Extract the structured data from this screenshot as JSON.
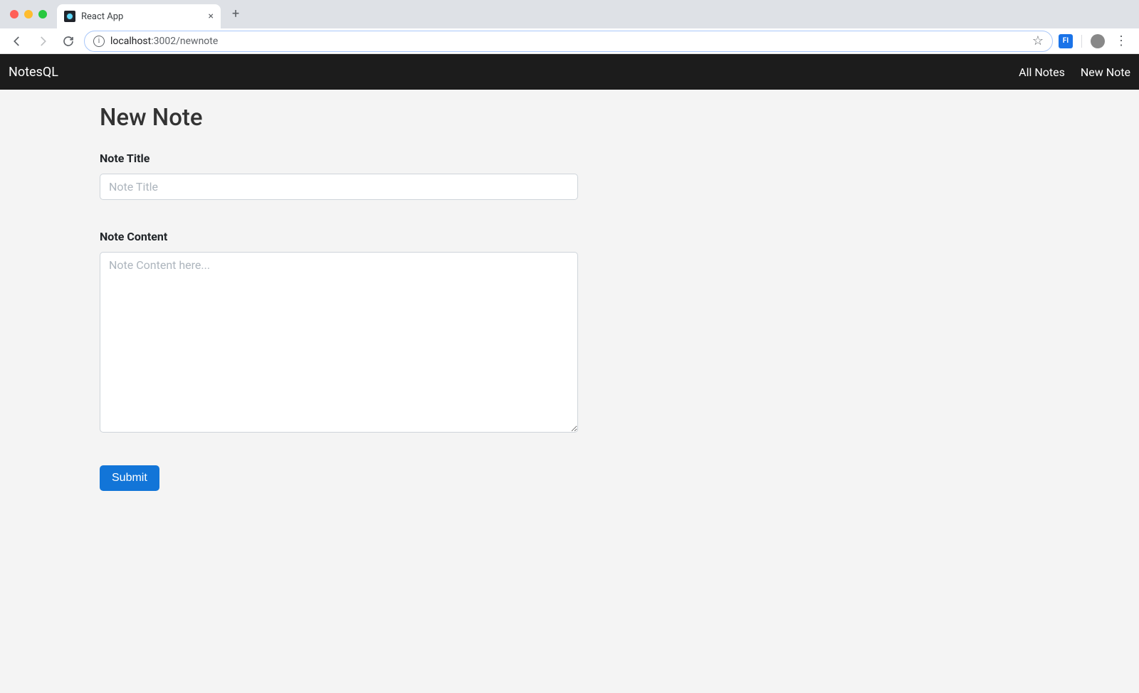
{
  "browser": {
    "tab_title": "React App",
    "url_host": "localhost",
    "url_rest": ":3002/newnote",
    "ext_badge": "FI"
  },
  "nav": {
    "brand": "NotesQL",
    "links": [
      {
        "label": "All Notes"
      },
      {
        "label": "New Note"
      }
    ]
  },
  "page": {
    "title": "New Note"
  },
  "form": {
    "title_label": "Note Title",
    "title_placeholder": "Note Title",
    "title_value": "",
    "content_label": "Note Content",
    "content_placeholder": "Note Content here...",
    "content_value": "",
    "submit_label": "Submit"
  }
}
